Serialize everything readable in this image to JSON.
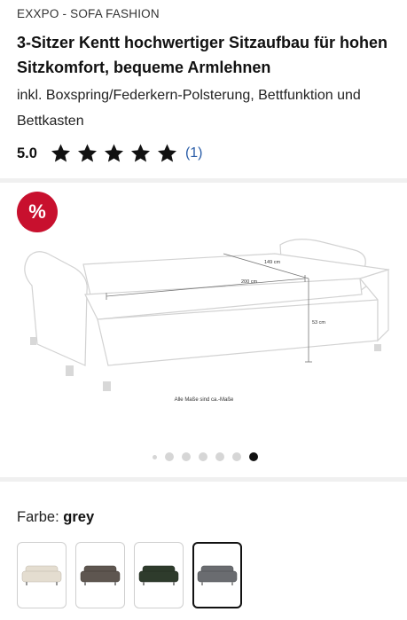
{
  "product": {
    "brand": "EXXPO - SOFA FASHION",
    "title": "3-Sitzer Kentt hochwertiger Sitzaufbau für hohen Sitzkomfort, bequeme Armlehnen",
    "subtitle": "inkl. Boxspring/Federkern-Polsterung, Bettfunktion und Bettkasten"
  },
  "rating": {
    "value": "5.0",
    "stars": 5,
    "review_count": "(1)",
    "star_color": "#111111"
  },
  "gallery": {
    "sale_badge": "%",
    "badge_color": "#c8102e",
    "dimensions": {
      "depth": "149 cm",
      "width": "200 cm",
      "height": "53 cm"
    },
    "note": "Alle Maße sind ca.-Maße",
    "dot_count": 7,
    "active_dot": 7
  },
  "color": {
    "label": "Farbe:",
    "selected": "grey",
    "swatches": [
      {
        "name": "beige",
        "color": "#e4ddd0",
        "selected": false
      },
      {
        "name": "brown",
        "color": "#5e5650",
        "selected": false
      },
      {
        "name": "green",
        "color": "#2e3b2c",
        "selected": false
      },
      {
        "name": "grey",
        "color": "#6a6c70",
        "selected": true
      }
    ]
  }
}
